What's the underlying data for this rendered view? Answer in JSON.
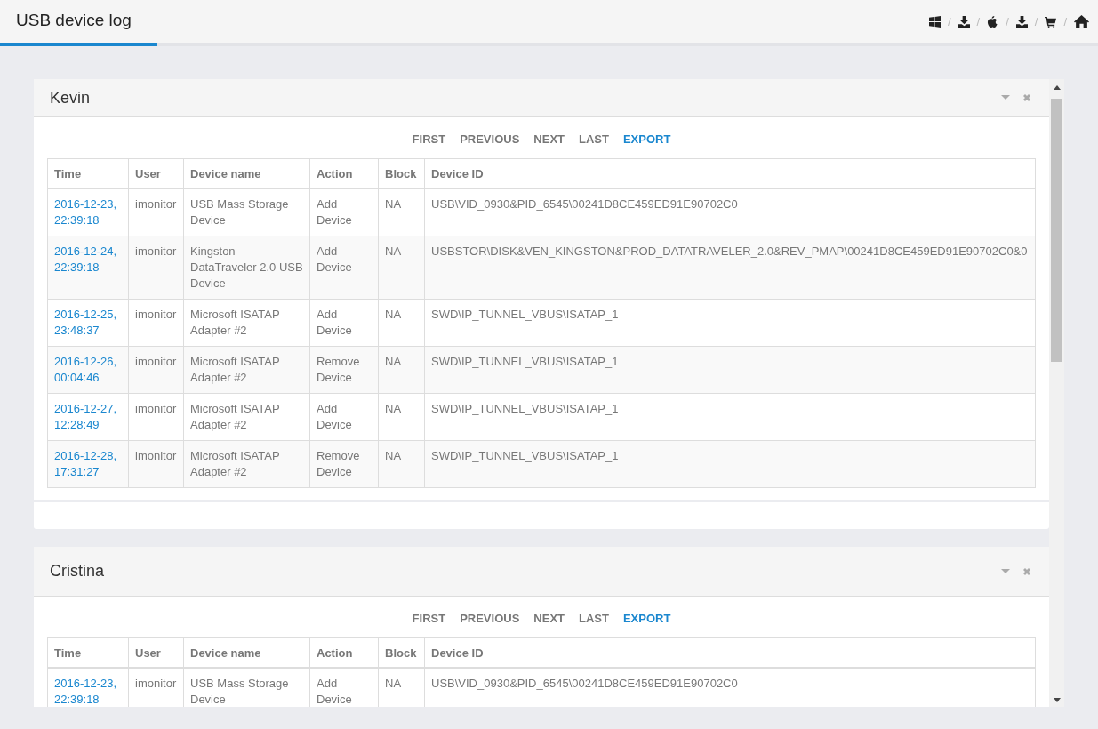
{
  "header": {
    "title": "USB device log",
    "toolbar_separators": [
      "/",
      "/",
      "/",
      "/",
      "/"
    ]
  },
  "panels": [
    {
      "title": "Kevin",
      "pager": [
        {
          "label": "FIRST",
          "kind": "nav"
        },
        {
          "label": "PREVIOUS",
          "kind": "nav"
        },
        {
          "label": "NEXT",
          "kind": "nav"
        },
        {
          "label": "LAST",
          "kind": "nav"
        },
        {
          "label": "EXPORT",
          "kind": "export"
        }
      ],
      "columns": [
        "Time",
        "User",
        "Device name",
        "Action",
        "Block",
        "Device ID"
      ],
      "rows": [
        [
          "2016-12-23, 22:39:18",
          "imonitor",
          "USB Mass Storage Device",
          "Add Device",
          "NA",
          "USB\\VID_0930&PID_6545\\00241D8CE459ED91E90702C0"
        ],
        [
          "2016-12-24, 22:39:18",
          "imonitor",
          "Kingston DataTraveler 2.0 USB Device",
          "Add Device",
          "NA",
          "USBSTOR\\DISK&VEN_KINGSTON&PROD_DATATRAVELER_2.0&REV_PMAP\\00241D8CE459ED91E90702C0&0"
        ],
        [
          "2016-12-25, 23:48:37",
          "imonitor",
          "Microsoft ISATAP Adapter #2",
          "Add Device",
          "NA",
          "SWD\\IP_TUNNEL_VBUS\\ISATAP_1"
        ],
        [
          "2016-12-26, 00:04:46",
          "imonitor",
          "Microsoft ISATAP Adapter #2",
          "Remove Device",
          "NA",
          "SWD\\IP_TUNNEL_VBUS\\ISATAP_1"
        ],
        [
          "2016-12-27, 12:28:49",
          "imonitor",
          "Microsoft ISATAP Adapter #2",
          "Add Device",
          "NA",
          "SWD\\IP_TUNNEL_VBUS\\ISATAP_1"
        ],
        [
          "2016-12-28, 17:31:27",
          "imonitor",
          "Microsoft ISATAP Adapter #2",
          "Remove Device",
          "NA",
          "SWD\\IP_TUNNEL_VBUS\\ISATAP_1"
        ]
      ]
    },
    {
      "title": "Cristina",
      "pager": [
        {
          "label": "FIRST",
          "kind": "nav"
        },
        {
          "label": "PREVIOUS",
          "kind": "nav"
        },
        {
          "label": "NEXT",
          "kind": "nav"
        },
        {
          "label": "LAST",
          "kind": "nav"
        },
        {
          "label": "EXPORT",
          "kind": "export"
        }
      ],
      "columns": [
        "Time",
        "User",
        "Device name",
        "Action",
        "Block",
        "Device ID"
      ],
      "rows": [
        [
          "2016-12-23, 22:39:18",
          "imonitor",
          "USB Mass Storage Device",
          "Add Device",
          "NA",
          "USB\\VID_0930&PID_6545\\00241D8CE459ED91E90702C0"
        ]
      ]
    }
  ]
}
